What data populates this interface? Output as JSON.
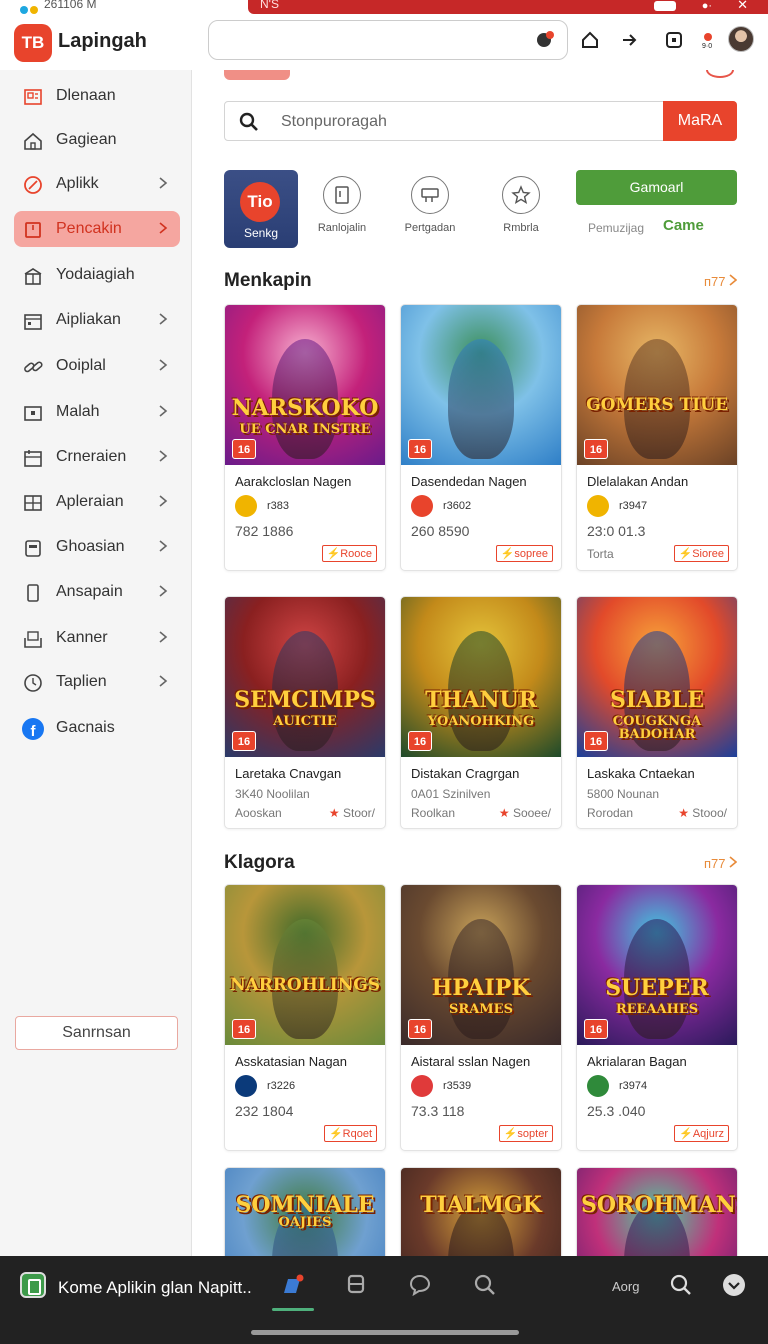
{
  "status_bar": {
    "time": "261106 M",
    "notice": "N'S"
  },
  "header": {
    "app_name": "Lapingah",
    "logo_text": "TB",
    "search_value": ""
  },
  "sidebar": {
    "items": [
      {
        "label": "Dlenaan",
        "icon": "news-icon",
        "chevron": false,
        "active": false
      },
      {
        "label": "Gagiean",
        "icon": "home-icon",
        "chevron": false,
        "active": false
      },
      {
        "label": "Aplikk",
        "icon": "tag-icon",
        "chevron": true,
        "active": false
      },
      {
        "label": "Pencakin",
        "icon": "bookmark-icon",
        "chevron": true,
        "active": true
      },
      {
        "label": "Yodaiagiah",
        "icon": "gift-icon",
        "chevron": false,
        "active": false
      },
      {
        "label": "Aipliakan",
        "icon": "calendar-icon",
        "chevron": true,
        "active": false
      },
      {
        "label": "Ooiplal",
        "icon": "link-icon",
        "chevron": true,
        "active": false
      },
      {
        "label": "Malah",
        "icon": "wallet-icon",
        "chevron": true,
        "active": false
      },
      {
        "label": "Crneraien",
        "icon": "calendar-list-icon",
        "chevron": true,
        "active": false
      },
      {
        "label": "Apleraian",
        "icon": "grid-icon",
        "chevron": true,
        "active": false
      },
      {
        "label": "Ghoasian",
        "icon": "folder-icon",
        "chevron": true,
        "active": false
      },
      {
        "label": "Ansapain",
        "icon": "phone-icon",
        "chevron": true,
        "active": false
      },
      {
        "label": "Kanner",
        "icon": "inbox-icon",
        "chevron": true,
        "active": false
      },
      {
        "label": "Taplien",
        "icon": "clock-icon",
        "chevron": true,
        "active": false
      },
      {
        "label": "Gacnais",
        "icon": "facebook-icon",
        "chevron": false,
        "active": false
      }
    ],
    "footer_button": "Sanrnsan"
  },
  "main": {
    "search": {
      "placeholder": "Stonpuroragah",
      "button": "MaRA"
    },
    "categories": {
      "featured": {
        "logo": "Tio",
        "label": "Senkg"
      },
      "items": [
        {
          "label": "Ranlojalin",
          "icon": "document-icon"
        },
        {
          "label": "Pertgadan",
          "icon": "cart-icon"
        },
        {
          "label": "Rmbrla",
          "icon": "star-icon"
        }
      ],
      "green_button": "Gamoarl",
      "green_sub": "Pemuzijag",
      "green_link": "Came"
    },
    "sections": [
      {
        "title": "Menkapin",
        "more": "ᴨ77",
        "cards": [
          {
            "art_title": "NARSKOKO",
            "art_sub": "UE CNAR INSTRE",
            "name": "Aarakcloslan Nagen",
            "meta": "r383",
            "nums": "782 1886",
            "footer_left": "",
            "tag": "Rooce",
            "badge": "16"
          },
          {
            "art_title": "",
            "art_sub": "",
            "name": "Dasendedan Nagen",
            "meta": "r3602",
            "nums": "260 8590",
            "footer_left": "",
            "tag": "sopree",
            "badge": "16"
          },
          {
            "art_title": "GOMERS TIUE",
            "art_sub": "",
            "name": "Dlelalakan Andan",
            "meta": "r3947",
            "nums": "23:0 01.3",
            "footer_left": "Torta",
            "tag": "Sioree",
            "badge": "16"
          }
        ]
      },
      {
        "title": "",
        "more": "",
        "cards": [
          {
            "art_title": "SEMCIMPS",
            "art_sub": "AUICTIE",
            "name": "Laretaka Cnavgan",
            "sub": "3K40 Noolilan",
            "foot_left": "Aooskan",
            "foot_right": "Stoor/",
            "badge": "16"
          },
          {
            "art_title": "THANUR",
            "art_sub": "YOANOHKING",
            "name": "Distakan Cragrgan",
            "sub": "0A01 Szinilven",
            "foot_left": "Roolkan",
            "foot_right": "Sooee/",
            "badge": "16"
          },
          {
            "art_title": "SIABLE",
            "art_sub": "COUGKNGA BADOHAR",
            "name": "Laskaka Cntaekan",
            "sub": "5800 Nounan",
            "foot_left": "Rorodan",
            "foot_right": "Stooo/",
            "badge": "16"
          }
        ]
      },
      {
        "title": "Klagora",
        "more": "ᴨ77",
        "cards": [
          {
            "art_title": "NARROHLINGS",
            "art_sub": "",
            "name": "Asskatasian Nagan",
            "meta": "r3226",
            "nums": "232 1804",
            "footer_left": "",
            "tag": "Rqoet",
            "badge": "16"
          },
          {
            "art_title": "HPAIPK",
            "art_sub": "SRAMES",
            "name": "Aistaral sslan Nagen",
            "meta": "r3539",
            "nums": "73.3 118",
            "footer_left": "",
            "tag": "sopter",
            "badge": "16"
          },
          {
            "art_title": "SUEPER",
            "art_sub": "REEAAHES",
            "name": "Akrialaran Bagan",
            "meta": "r3974",
            "nums": "25.3 .040",
            "footer_left": "",
            "tag": "Aqjurz",
            "badge": "16"
          }
        ]
      },
      {
        "title": "",
        "more": "",
        "cards": [
          {
            "art_title": "SOMNIALE",
            "art_sub": "OAJIES"
          },
          {
            "art_title": "TIALMGK",
            "art_sub": ""
          },
          {
            "art_title": "SOROHMANS",
            "art_sub": ""
          }
        ]
      }
    ]
  },
  "bottom_bar": {
    "title": "Kome Aplikin glan Napitt..",
    "label": "Aorg"
  },
  "colors": {
    "accent": "#e8442c",
    "green": "#4f9c3a",
    "nav_active_bg": "#f5a6a0"
  }
}
